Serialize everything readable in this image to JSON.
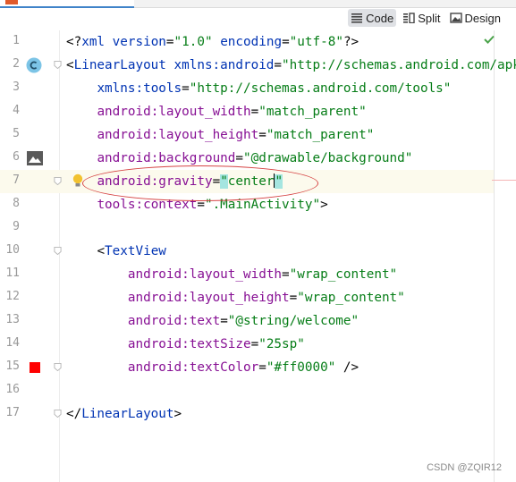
{
  "tab": {
    "title": ""
  },
  "toolbar": {
    "views": [
      {
        "label": "Code",
        "icon": "code-view-icon",
        "selected": true
      },
      {
        "label": "Split",
        "icon": "split-view-icon",
        "selected": false
      },
      {
        "label": "Design",
        "icon": "design-view-icon",
        "selected": false
      }
    ]
  },
  "editor": {
    "lines": [
      {
        "n": "1",
        "tokens": [
          {
            "t": "<?",
            "c": "plain"
          },
          {
            "t": "xml ",
            "c": "tag"
          },
          {
            "t": "version",
            "c": "tag"
          },
          {
            "t": "=",
            "c": "plain"
          },
          {
            "t": "\"1.0\"",
            "c": "val"
          },
          {
            "t": " ",
            "c": "plain"
          },
          {
            "t": "encoding",
            "c": "tag"
          },
          {
            "t": "=",
            "c": "plain"
          },
          {
            "t": "\"utf-8\"",
            "c": "val"
          },
          {
            "t": "?>",
            "c": "plain"
          }
        ]
      },
      {
        "n": "2",
        "tokens": [
          {
            "t": "<",
            "c": "plain"
          },
          {
            "t": "LinearLayout ",
            "c": "tag"
          },
          {
            "t": "xmlns:android",
            "c": "tag"
          },
          {
            "t": "=",
            "c": "plain"
          },
          {
            "t": "\"http://schemas.android.com/apk/res/android\"",
            "c": "val"
          }
        ]
      },
      {
        "n": "3",
        "tokens": [
          {
            "t": "    ",
            "c": "plain"
          },
          {
            "t": "xmlns:tools",
            "c": "tag"
          },
          {
            "t": "=",
            "c": "plain"
          },
          {
            "t": "\"http://schemas.android.com/tools\"",
            "c": "val"
          }
        ]
      },
      {
        "n": "4",
        "tokens": [
          {
            "t": "    ",
            "c": "plain"
          },
          {
            "t": "android",
            "c": "ns"
          },
          {
            "t": ":layout_width",
            "c": "attr"
          },
          {
            "t": "=",
            "c": "plain"
          },
          {
            "t": "\"match_parent\"",
            "c": "val"
          }
        ]
      },
      {
        "n": "5",
        "tokens": [
          {
            "t": "    ",
            "c": "plain"
          },
          {
            "t": "android",
            "c": "ns"
          },
          {
            "t": ":layout_height",
            "c": "attr"
          },
          {
            "t": "=",
            "c": "plain"
          },
          {
            "t": "\"match_parent\"",
            "c": "val"
          }
        ]
      },
      {
        "n": "6",
        "tokens": [
          {
            "t": "    ",
            "c": "plain"
          },
          {
            "t": "android",
            "c": "ns"
          },
          {
            "t": ":background",
            "c": "attr"
          },
          {
            "t": "=",
            "c": "plain"
          },
          {
            "t": "\"@drawable/background\"",
            "c": "val"
          }
        ]
      },
      {
        "n": "7",
        "tokens": [
          {
            "t": "    ",
            "c": "plain"
          },
          {
            "t": "android",
            "c": "ns"
          },
          {
            "t": ":gravity",
            "c": "attr"
          },
          {
            "t": "=",
            "c": "plain"
          },
          {
            "t": "\"",
            "c": "val",
            "hl": true
          },
          {
            "t": "center",
            "c": "val"
          },
          {
            "t": "",
            "c": "caret"
          },
          {
            "t": "\"",
            "c": "val",
            "hl": true
          }
        ]
      },
      {
        "n": "8",
        "tokens": [
          {
            "t": "    ",
            "c": "plain"
          },
          {
            "t": "tools",
            "c": "ns"
          },
          {
            "t": ":context",
            "c": "attr"
          },
          {
            "t": "=",
            "c": "plain"
          },
          {
            "t": "\".MainActivity\"",
            "c": "val"
          },
          {
            "t": ">",
            "c": "plain"
          }
        ]
      },
      {
        "n": "9",
        "tokens": []
      },
      {
        "n": "10",
        "tokens": [
          {
            "t": "    ",
            "c": "plain"
          },
          {
            "t": "<",
            "c": "plain"
          },
          {
            "t": "TextView",
            "c": "tag"
          }
        ]
      },
      {
        "n": "11",
        "tokens": [
          {
            "t": "        ",
            "c": "plain"
          },
          {
            "t": "android",
            "c": "ns"
          },
          {
            "t": ":layout_width",
            "c": "attr"
          },
          {
            "t": "=",
            "c": "plain"
          },
          {
            "t": "\"wrap_content\"",
            "c": "val"
          }
        ]
      },
      {
        "n": "12",
        "tokens": [
          {
            "t": "        ",
            "c": "plain"
          },
          {
            "t": "android",
            "c": "ns"
          },
          {
            "t": ":layout_height",
            "c": "attr"
          },
          {
            "t": "=",
            "c": "plain"
          },
          {
            "t": "\"wrap_content\"",
            "c": "val"
          }
        ]
      },
      {
        "n": "13",
        "tokens": [
          {
            "t": "        ",
            "c": "plain"
          },
          {
            "t": "android",
            "c": "ns"
          },
          {
            "t": ":text",
            "c": "attr"
          },
          {
            "t": "=",
            "c": "plain"
          },
          {
            "t": "\"@string/welcome\"",
            "c": "val"
          }
        ]
      },
      {
        "n": "14",
        "tokens": [
          {
            "t": "        ",
            "c": "plain"
          },
          {
            "t": "android",
            "c": "ns"
          },
          {
            "t": ":textSize",
            "c": "attr"
          },
          {
            "t": "=",
            "c": "plain"
          },
          {
            "t": "\"25sp\"",
            "c": "val"
          }
        ]
      },
      {
        "n": "15",
        "tokens": [
          {
            "t": "        ",
            "c": "plain"
          },
          {
            "t": "android",
            "c": "ns"
          },
          {
            "t": ":textColor",
            "c": "attr"
          },
          {
            "t": "=",
            "c": "plain"
          },
          {
            "t": "\"#ff0000\"",
            "c": "val"
          },
          {
            "t": " />",
            "c": "plain"
          }
        ]
      },
      {
        "n": "16",
        "tokens": []
      },
      {
        "n": "17",
        "tokens": [
          {
            "t": "</",
            "c": "plain"
          },
          {
            "t": "LinearLayout",
            "c": "tag"
          },
          {
            "t": ">",
            "c": "plain"
          }
        ]
      }
    ],
    "current_line": "7",
    "gutter_icons": {
      "2": "class-icon",
      "6": "image-preview-icon",
      "7": "lightbulb-icon",
      "15": "color-swatch-icon"
    },
    "color_swatch": "#ff0000",
    "fold_lines": [
      "2",
      "7",
      "10",
      "15",
      "17"
    ]
  },
  "watermark": "CSDN @ZQIR12",
  "colors": {
    "tag": "#0033b3",
    "attribute": "#871094",
    "value": "#067d17",
    "annotation_oval": "#d64545",
    "selected_view": "#dfe1e5"
  }
}
